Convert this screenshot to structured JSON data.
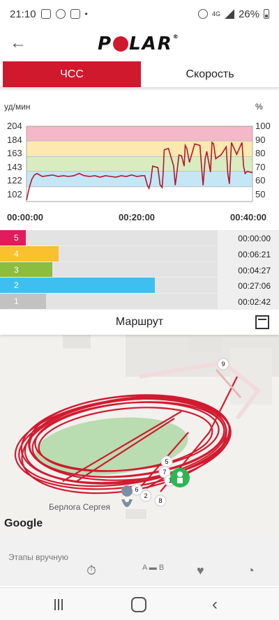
{
  "status": {
    "time": "21:10",
    "network": "4G",
    "battery": "26%"
  },
  "app": {
    "logo": "POLAR",
    "back_icon": "arrow-left-icon"
  },
  "tabs": [
    {
      "label": "ЧСС",
      "active": true
    },
    {
      "label": "Скорость",
      "active": false
    }
  ],
  "chart_data": {
    "type": "line",
    "ylabel_left": "уд/мин",
    "ylabel_right": "%",
    "y_ticks_left": [
      "204",
      "184",
      "163",
      "143",
      "122",
      "102"
    ],
    "y_ticks_right": [
      "100",
      "90",
      "80",
      "70",
      "60",
      "50"
    ],
    "x_ticks": [
      "00:00:00",
      "00:20:00",
      "00:40:00"
    ],
    "ylim": [
      102,
      204
    ],
    "xlim_min": [
      0,
      43
    ],
    "zones": [
      {
        "zone": 5,
        "range": [
          184,
          204
        ],
        "color": "#f4b8c8"
      },
      {
        "zone": 4,
        "range": [
          163,
          184
        ],
        "color": "#fde9b0"
      },
      {
        "zone": 3,
        "range": [
          143,
          163
        ],
        "color": "#d9ecc0"
      },
      {
        "zone": 2,
        "range": [
          122,
          143
        ],
        "color": "#c4e6f5"
      }
    ],
    "series": [
      {
        "color": "#b0182e",
        "x": [
          0,
          0.5,
          1,
          1.5,
          2,
          3,
          4,
          5,
          6,
          7,
          8,
          9,
          10,
          11,
          12,
          13,
          14,
          15,
          16,
          17,
          18,
          19,
          20,
          21,
          22,
          22.5,
          23,
          23.3,
          23.6,
          24,
          25,
          25.4,
          25.8,
          26,
          26.2,
          27,
          28,
          28.3,
          28.6,
          29,
          29.5,
          30,
          30.2,
          30.5,
          31,
          32,
          33,
          33.3,
          33.6,
          34,
          34.3,
          35,
          35.3,
          35.6,
          36,
          37,
          38,
          38.3,
          38.6,
          39,
          40,
          41,
          41.3,
          41.6,
          42,
          43
        ],
        "y": [
          104,
          120,
          132,
          138,
          140,
          136,
          137,
          138,
          136,
          137,
          136,
          137,
          140,
          137,
          136,
          137,
          135,
          137,
          136,
          135,
          137,
          136,
          138,
          136,
          137,
          137,
          124,
          120,
          128,
          150,
          148,
          125,
          121,
          140,
          172,
          174,
          150,
          124,
          140,
          165,
          164,
          150,
          178,
          174,
          155,
          180,
          178,
          150,
          124,
          160,
          170,
          142,
          182,
          180,
          160,
          165,
          176,
          140,
          126,
          182,
          166,
          182,
          150,
          140,
          143,
          141
        ]
      }
    ]
  },
  "zone_bars": [
    {
      "zone": "5",
      "time": "00:00:00",
      "color": "#e01c5e",
      "fraction": 0.12
    },
    {
      "zone": "4",
      "time": "00:06:21",
      "color": "#fbc02d",
      "fraction": 0.27
    },
    {
      "zone": "3",
      "time": "00:04:27",
      "color": "#8bbd3f",
      "fraction": 0.24
    },
    {
      "zone": "2",
      "time": "00:27:06",
      "color": "#3fbff0",
      "fraction": 0.71
    },
    {
      "zone": "1",
      "time": "00:02:42",
      "color": "#c2c2c2",
      "fraction": 0.21
    }
  ],
  "route": {
    "title": "Маршрут",
    "icon": "expand-icon"
  },
  "map": {
    "poi": "Берлога Сергея",
    "google": "Google",
    "markers": [
      "9",
      "5",
      "7",
      "1",
      "6",
      "2",
      "8"
    ]
  },
  "laps": {
    "title": "Этапы вручную",
    "icons": [
      "stopwatch-icon",
      "ruler-icon",
      "heart-icon",
      "speed-icon"
    ]
  }
}
